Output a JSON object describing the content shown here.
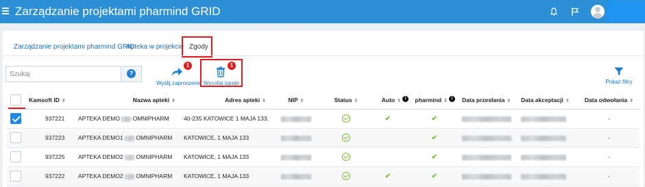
{
  "app": {
    "title": "Zarządzanie projektami pharmind GRID"
  },
  "tabs": [
    {
      "label": "Zarządzanie projektami pharmind GRID"
    },
    {
      "label": "Apteka w projekcie"
    },
    {
      "label": "Zgody"
    }
  ],
  "search": {
    "placeholder": "Szukaj",
    "help_label": "?"
  },
  "actions": {
    "invite": {
      "label": "Wyślij zaproszenie",
      "badge": "1"
    },
    "withdraw": {
      "label": "Wycofaj zgodę",
      "badge": "1"
    },
    "filters": {
      "label": "Pokaż filtry"
    }
  },
  "table": {
    "columns": [
      "Kamsoft ID",
      "Nazwa apteki",
      "Adres apteki",
      "NIP",
      "Status",
      "Auto",
      "pharmind",
      "Data przesłania",
      "Data akceptacji",
      "Data odwołania"
    ],
    "info_mark": "i",
    "rows": [
      {
        "checked": true,
        "id": "937221",
        "name_a": "APTEKA DEMO",
        "name_b": "OMNIPHARM",
        "address": "40-235 KATOWICE 1 MAJA 133,",
        "auto": "✔",
        "pharmind": "✔",
        "withdrawn": "-"
      },
      {
        "checked": false,
        "id": "937223",
        "name_a": "APTEKA DEMO1",
        "name_b": "OMNIPHARM",
        "address": "KATOWICE, 1 MAJA 133",
        "auto": "",
        "pharmind": "✔",
        "withdrawn": "-"
      },
      {
        "checked": false,
        "id": "937225",
        "name_a": "APTEKA DEMO2",
        "name_b": "OMNIPHARM",
        "address": "KATOWICE, 1 MAJA 133",
        "auto": "",
        "pharmind": "✔",
        "withdrawn": "-"
      },
      {
        "checked": false,
        "id": "937222",
        "name_a": "APTEKA DEMO2",
        "name_b": "OMNIPHARM",
        "address": "KATOWICE, 1 MAJA 133",
        "auto": "✔",
        "pharmind": "✔",
        "withdrawn": "-"
      }
    ]
  },
  "colors": {
    "brand": "#2d8fd6",
    "accent": "#1e88e5",
    "success": "#7bbf2e",
    "highlight": "#e0191b"
  }
}
